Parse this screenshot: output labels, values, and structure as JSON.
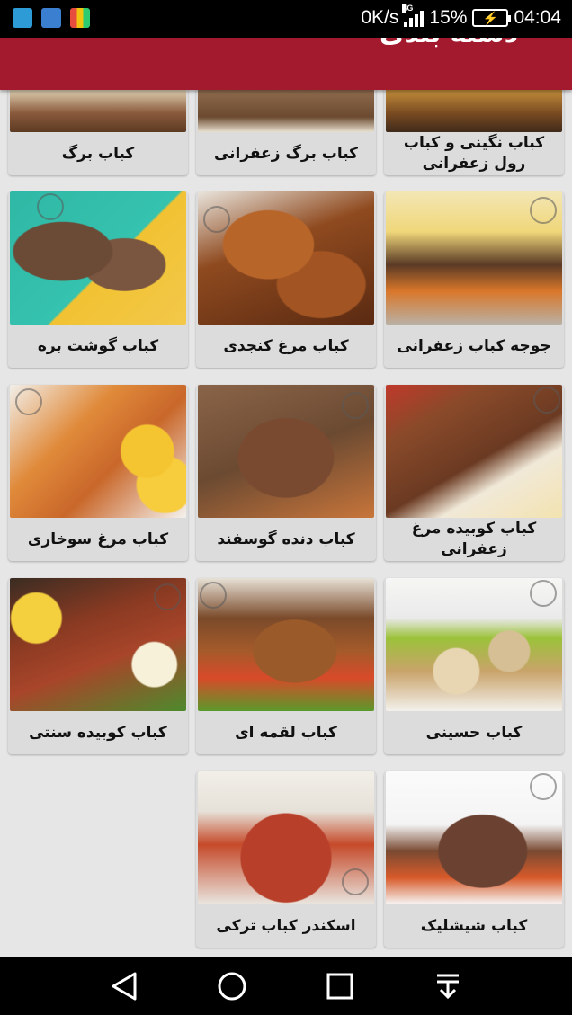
{
  "status_bar": {
    "speed": "0K/s",
    "network": "4G",
    "battery_percent": "15%",
    "time": "04:04"
  },
  "app_bar": {
    "title": "دسته بندی"
  },
  "items": [
    {
      "label": "کباب برگ",
      "partial": true
    },
    {
      "label": "کباب برگ زعفرانی",
      "partial": true
    },
    {
      "label": "کباب نگینی و کباب رول زعفرانی",
      "partial": true
    },
    {
      "label": "کباب گوشت بره"
    },
    {
      "label": "کباب مرغ کنجدی"
    },
    {
      "label": "جوجه کباب زعفرانی"
    },
    {
      "label": "کباب مرغ سوخاری"
    },
    {
      "label": "کباب دنده گوسفند"
    },
    {
      "label": "کباب کوبیده مرغ زعفرانی"
    },
    {
      "label": "کباب کوبیده سنتی"
    },
    {
      "label": "کباب لقمه ای"
    },
    {
      "label": "کباب حسینی"
    },
    {
      "label": "اسکندر کباب ترکی"
    },
    {
      "label": "کباب شیشلیک"
    }
  ],
  "nav": {
    "back_icon": "triangle-back-icon",
    "home_icon": "circle-home-icon",
    "recent_icon": "square-recent-icon",
    "menu_icon": "notification-pulldown-icon"
  },
  "colors": {
    "app_bar": "#a31a2e",
    "background": "#e6e6e6",
    "card": "#dcdcdc"
  }
}
